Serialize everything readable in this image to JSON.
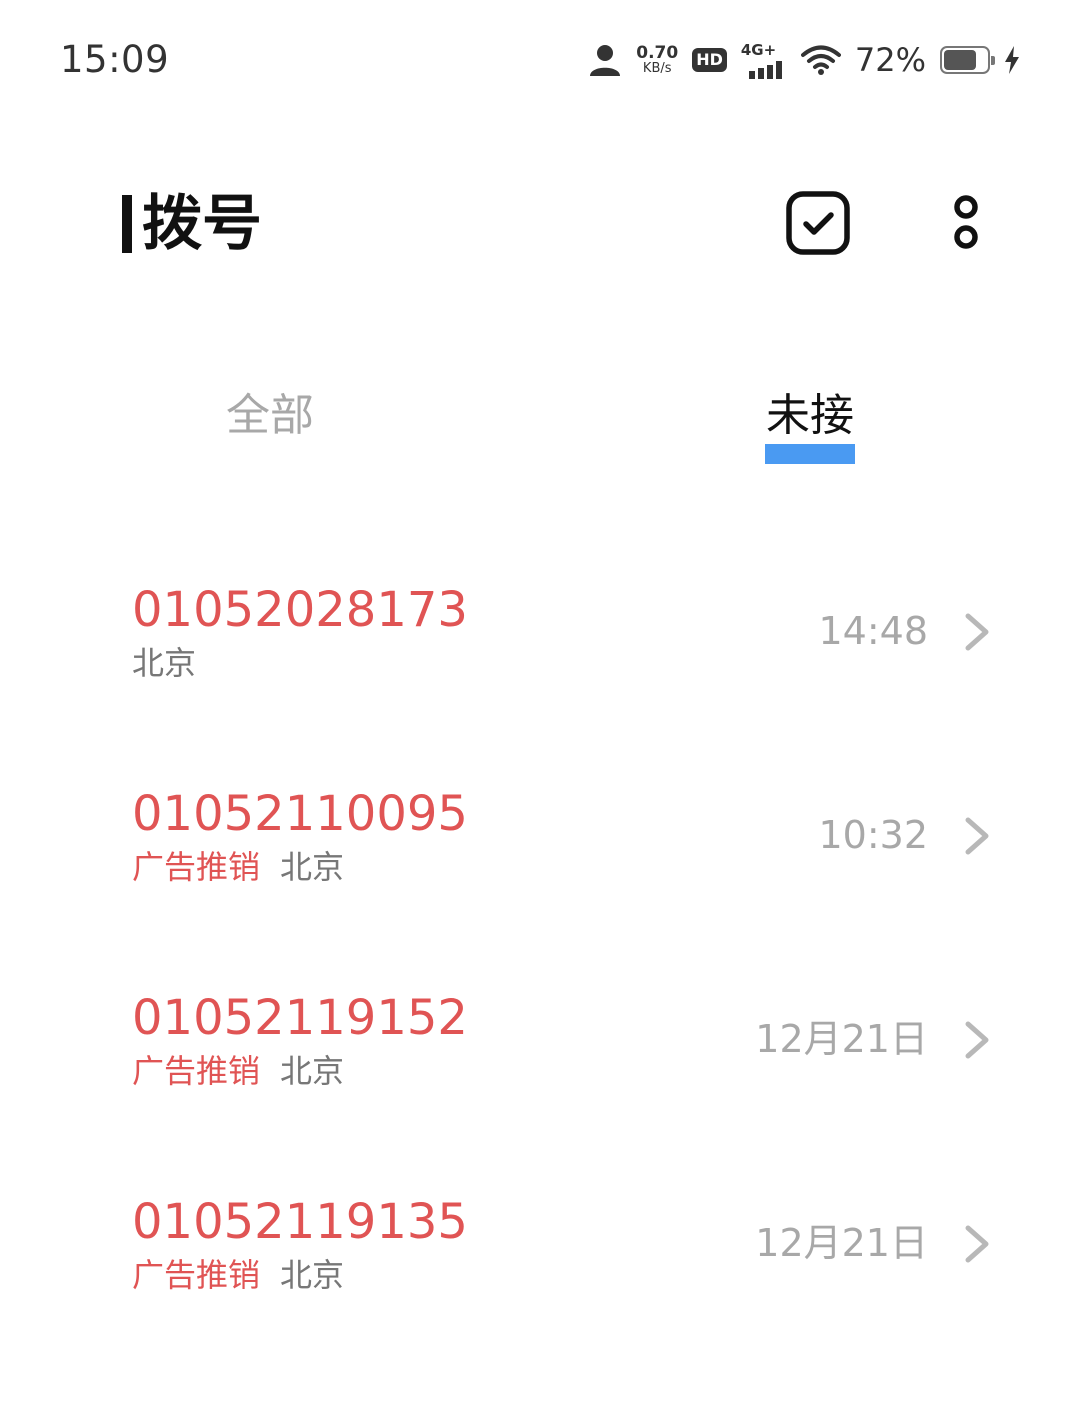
{
  "status_bar": {
    "time": "15:09",
    "net_speed_value": "0.70",
    "net_speed_unit": "KB/s",
    "hd_label": "HD",
    "net_type": "4G+",
    "battery_percent": "72%",
    "battery_level": 0.72,
    "icons": [
      "person-icon",
      "signal-icon",
      "wifi-icon",
      "battery-icon",
      "charging-icon"
    ]
  },
  "header": {
    "title": "拨号",
    "actions": [
      "check-square-icon",
      "more-vertical-icon"
    ]
  },
  "tabs": [
    {
      "label": "全部",
      "active": false
    },
    {
      "label": "未接",
      "active": true
    }
  ],
  "calls": [
    {
      "number": "01052028173",
      "tag": "",
      "location": "北京",
      "time": "14:48"
    },
    {
      "number": "01052110095",
      "tag": "广告推销",
      "location": "北京",
      "time": "10:32"
    },
    {
      "number": "01052119152",
      "tag": "广告推销",
      "location": "北京",
      "time": "12月21日"
    },
    {
      "number": "01052119135",
      "tag": "广告推销",
      "location": "北京",
      "time": "12月21日"
    }
  ],
  "colors": {
    "missed_red": "#e05454",
    "accent_blue": "#4a9af2",
    "muted_gray": "#a8a8a8"
  }
}
